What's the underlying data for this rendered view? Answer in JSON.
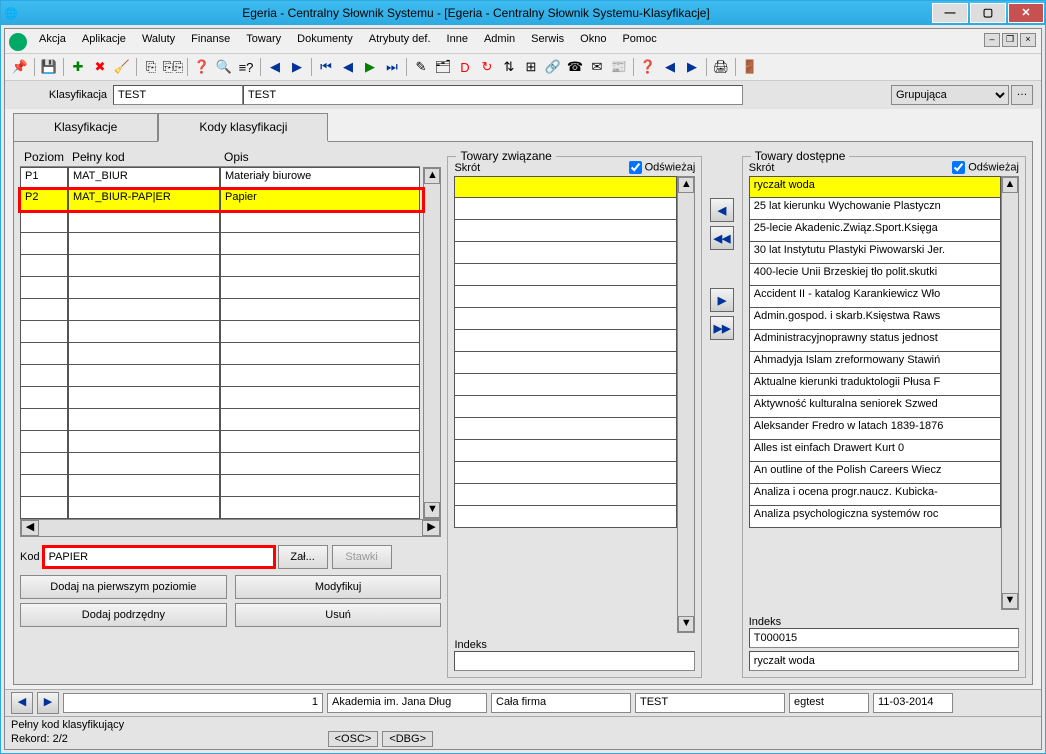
{
  "title": "Egeria - Centralny Słownik Systemu - [Egeria - Centralny Słownik Systemu-Klasyfikacje]",
  "menu": [
    "Akcja",
    "Aplikacje",
    "Waluty",
    "Finanse",
    "Towary",
    "Dokumenty",
    "Atrybuty def.",
    "Inne",
    "Admin",
    "Serwis",
    "Okno",
    "Pomoc"
  ],
  "klas": {
    "label": "Klasyfikacja",
    "code": "TEST",
    "code2": "TEST",
    "type": "Grupująca"
  },
  "tabs": [
    "Klasyfikacje",
    "Kody klasyfikacji"
  ],
  "hdr": {
    "poziom": "Poziom",
    "pelny": "Pełny kod",
    "opis": "Opis"
  },
  "rows": [
    {
      "p": "P1",
      "k": "MAT_BIUR",
      "o": "Materiały biurowe",
      "y": false,
      "hl": false
    },
    {
      "p": "P2",
      "k": "MAT_BIUR-PAP|ER",
      "o": "Papier",
      "y": true,
      "hl": true
    }
  ],
  "kod": {
    "label": "Kod",
    "value": "PAPIER",
    "zal": "Zał...",
    "stawki": "Stawki"
  },
  "btns": {
    "d1": "Dodaj na pierwszym poziomie",
    "mod": "Modyfikuj",
    "d2": "Dodaj podrzędny",
    "usun": "Usuń"
  },
  "mid": {
    "title": "Towary związane",
    "skrot": "Skrót",
    "ods": "Odświeżaj",
    "indeks": "Indeks",
    "idxval": ""
  },
  "right": {
    "title": "Towary dostępne",
    "skrot": "Skrót",
    "ods": "Odświeżaj",
    "indeks": "Indeks",
    "idxval": "T000015",
    "desc": "ryczałt woda",
    "items": [
      "ryczałt woda",
      "25 lat kierunku Wychowanie Plastyczn",
      "25-lecie Akadenic.Związ.Sport.Księga",
      "30 lat Instytutu Plastyki Piwowarski Jer.",
      "400-lecie Unii Brzeskiej tło polit.skutki",
      "Accident II - katalog Karankiewicz Wło",
      "Admin.gospod. i skarb.Księstwa Raws",
      "Administracyjnoprawny status jednost",
      "Ahmadyja Islam zreformowany Stawiń",
      "Aktualne kierunki traduktologii Płusa F",
      "Aktywność kulturalna seniorek Szwed",
      "Aleksander Fredro w latach 1839-1876",
      "Alles ist einfach Drawert Kurt 0",
      "An outline of the Polish Careers Wiecz",
      "Analiza i ocena progr.naucz. Kubicka-",
      "Analiza psychologiczna systemów roc"
    ]
  },
  "nav": {
    "n1": "1",
    "n2": "Akademia im. Jana Dług",
    "n3": "Cała firma",
    "n4": "TEST",
    "n5": "egtest",
    "n6": "11-03-2014"
  },
  "status": {
    "s1": "Pełny kod klasyfikujący",
    "s2": "Rekord: 2/2",
    "osc": "<OSC>",
    "dbg": "<DBG>"
  }
}
